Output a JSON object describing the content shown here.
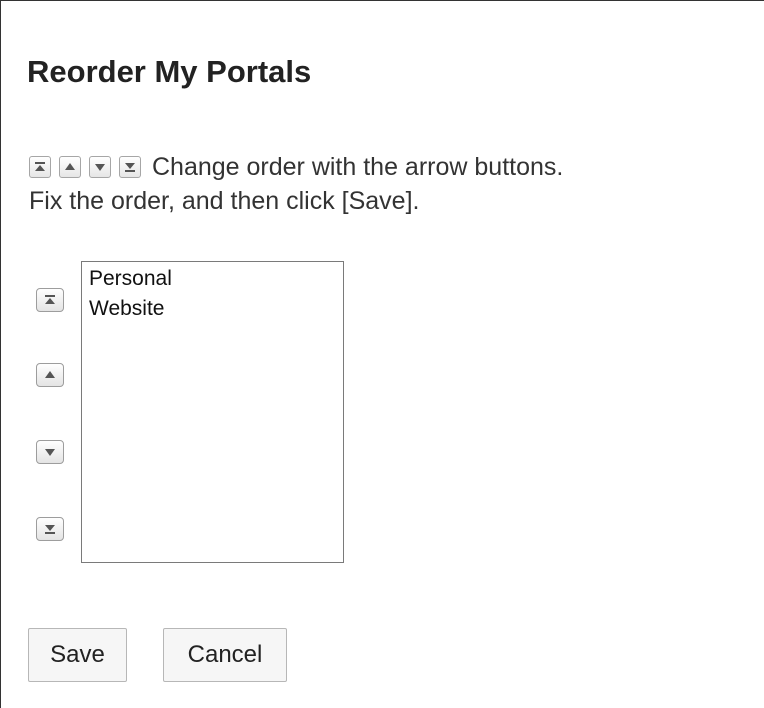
{
  "page": {
    "title": "Reorder My Portals"
  },
  "instructions": {
    "line1": "Change order with the arrow buttons.",
    "line2": "Fix the order, and then click [Save]."
  },
  "icons": {
    "top": "move-to-top-icon",
    "up": "move-up-icon",
    "down": "move-down-icon",
    "bottom": "move-to-bottom-icon"
  },
  "portal_list": {
    "items": [
      "Personal",
      "Website"
    ]
  },
  "actions": {
    "save_label": "Save",
    "cancel_label": "Cancel"
  },
  "colors": {
    "text": "#222222",
    "button_border": "#9d9d9d",
    "list_border": "#7a7a7a",
    "arrow": "#555555"
  }
}
